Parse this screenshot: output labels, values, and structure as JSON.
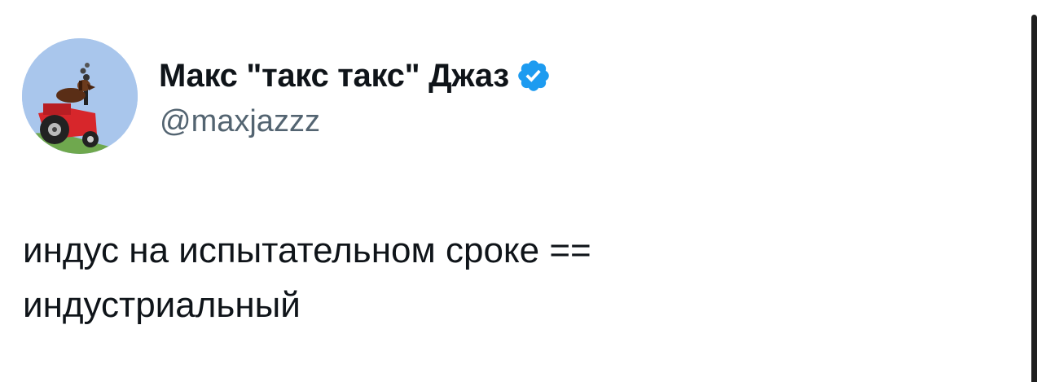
{
  "tweet": {
    "author": {
      "display_name": "Макс \"такс такс\" Джаз",
      "handle": "@maxjazzz",
      "verified": true,
      "avatar_icon": "dachshund-on-red-tractor-avatar"
    },
    "text_lines": [
      "индус на испытательном сроке ==",
      "индустриальный"
    ]
  },
  "colors": {
    "name": "#0f1419",
    "handle": "#536471",
    "verified_badge": "#1d9bf0",
    "avatar_background": "#a9c6ec"
  }
}
